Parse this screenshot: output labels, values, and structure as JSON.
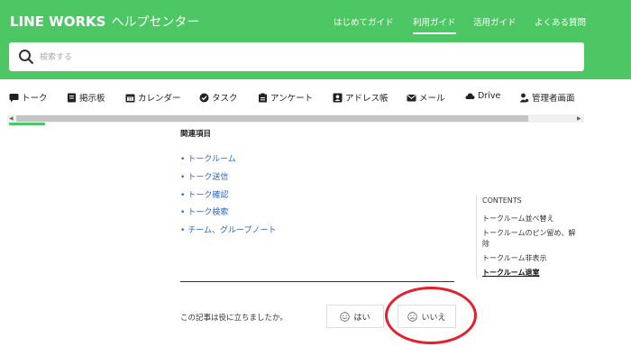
{
  "header": {
    "brand": "LINE WORKS",
    "brand_sub": "ヘルプセンター",
    "nav": [
      "はじめてガイド",
      "利用ガイド",
      "活用ガイド",
      "よくある質問"
    ]
  },
  "search": {
    "placeholder": "検索する"
  },
  "categories": [
    {
      "label": "トーク",
      "icon": "chat-icon"
    },
    {
      "label": "掲示板",
      "icon": "board-icon"
    },
    {
      "label": "カレンダー",
      "icon": "calendar-icon"
    },
    {
      "label": "タスク",
      "icon": "check-icon"
    },
    {
      "label": "アンケート",
      "icon": "survey-icon"
    },
    {
      "label": "アドレス帳",
      "icon": "contact-icon"
    },
    {
      "label": "メール",
      "icon": "mail-icon"
    },
    {
      "label": "Drive",
      "icon": "cloud-icon"
    },
    {
      "label": "管理者画面",
      "icon": "admin-icon"
    }
  ],
  "related": {
    "title": "関連項目",
    "items": [
      "トークルーム",
      "トーク送信",
      "トーク確認",
      "トーク検索",
      "チーム、グループノート"
    ]
  },
  "contents": {
    "title": "CONTENTS",
    "items": [
      "トークルーム並べ替え",
      "トークルームのピン留め、解",
      "除",
      "トークルーム非表示",
      "トークルーム退室"
    ]
  },
  "feedback": {
    "question": "この記事は役に立ちましたか。",
    "yes": "はい",
    "no": "いいえ"
  },
  "colors": {
    "brand_green": "#4cc764",
    "link_blue": "#2a66c9",
    "highlight_red": "#e3202b"
  }
}
